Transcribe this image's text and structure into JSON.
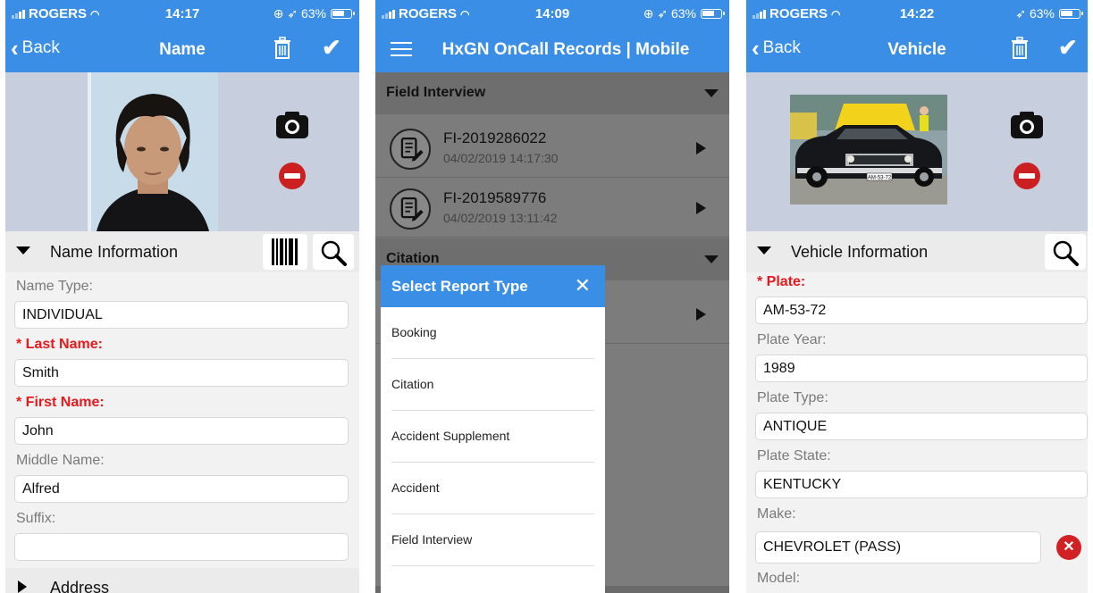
{
  "phone_name": {
    "status": {
      "carrier": "ROGERS",
      "time": "14:17",
      "right": "⊕ ➶ 63%"
    },
    "nav": {
      "back": "Back",
      "title": "Name"
    },
    "section": {
      "label": "Name Information"
    },
    "fields": [
      {
        "label": "Name Type:",
        "value": "INDIVIDUAL",
        "required": false
      },
      {
        "label": "* Last Name:",
        "value": "Smith",
        "required": true
      },
      {
        "label": "* First Name:",
        "value": "John",
        "required": true
      },
      {
        "label": "Middle Name:",
        "value": "Alfred",
        "required": false
      },
      {
        "label": "Suffix:",
        "value": "",
        "required": false
      }
    ],
    "next_section": "Address"
  },
  "phone_records": {
    "status": {
      "carrier": "ROGERS",
      "time": "14:09",
      "right": "⊕ ➶ 63%"
    },
    "nav": {
      "title": "HxGN OnCall Records | Mobile"
    },
    "groups": [
      {
        "title": "Field Interview"
      },
      {
        "title": "Citation"
      }
    ],
    "records": [
      {
        "id": "FI-2019286022",
        "date": "04/02/2019 14:17:30"
      },
      {
        "id": "FI-2019589776",
        "date": "04/02/2019 13:11:42"
      }
    ],
    "modal": {
      "title": "Select Report Type",
      "close": "✕",
      "options": [
        "Booking",
        "Citation",
        "Accident Supplement",
        "Accident",
        "Field Interview"
      ]
    }
  },
  "phone_vehicle": {
    "status": {
      "carrier": "ROGERS",
      "time": "14:22",
      "right": "➶ 63%"
    },
    "nav": {
      "back": "Back",
      "title": "Vehicle"
    },
    "section": {
      "label": "Vehicle Information"
    },
    "fields": [
      {
        "label": "* Plate:",
        "value": "AM-53-72",
        "required": true
      },
      {
        "label": "Plate Year:",
        "value": "1989",
        "required": false
      },
      {
        "label": "Plate Type:",
        "value": "ANTIQUE",
        "required": false
      },
      {
        "label": "Plate State:",
        "value": "KENTUCKY",
        "required": false
      },
      {
        "label": "Make:",
        "value": "CHEVROLET (PASS)",
        "required": false
      },
      {
        "label": "Model:",
        "value": "",
        "required": false
      }
    ],
    "plate_text": "AM-53-72"
  },
  "icons": [
    "signal-icon",
    "wifi-icon",
    "battery-icon",
    "chevron-left-icon",
    "trash-icon",
    "checkmark-icon",
    "camera-icon",
    "remove-icon",
    "barcode-icon",
    "search-icon",
    "menu-icon",
    "report-icon",
    "close-icon",
    "clear-icon"
  ],
  "colors": {
    "accent": "#3a8ee6",
    "required": "#e8191c",
    "remove": "#cc1f22",
    "photo_bg": "#c7cedd"
  }
}
